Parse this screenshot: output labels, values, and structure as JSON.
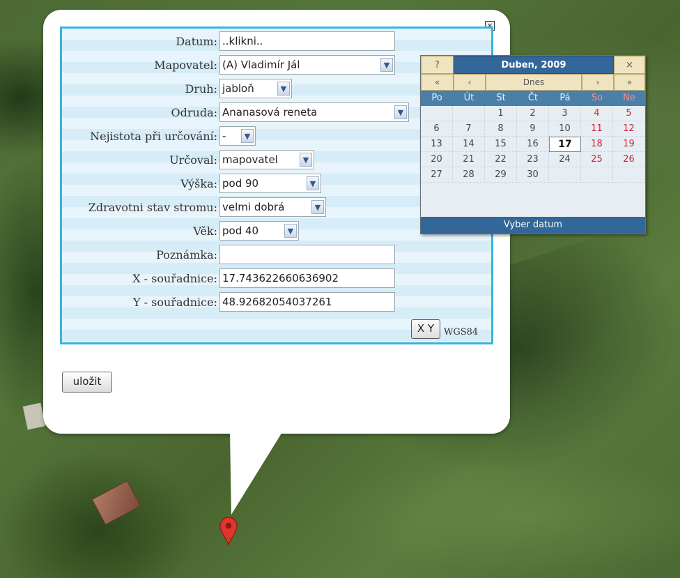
{
  "form": {
    "close_icon": "close-icon",
    "fields": [
      {
        "label": "Datum:",
        "value": "..klikni..",
        "type": "input"
      },
      {
        "label": "Mapovatel:",
        "value": "(A) Vladimír Jál",
        "type": "select"
      },
      {
        "label": "Druh:",
        "value": "jabloň",
        "type": "select"
      },
      {
        "label": "Odruda:",
        "value": "Ananasová reneta",
        "type": "select"
      },
      {
        "label": "Nejistota při určování:",
        "value": "-",
        "type": "select"
      },
      {
        "label": "Určoval:",
        "value": "mapovatel",
        "type": "select"
      },
      {
        "label": "Výška:",
        "value": "pod 90",
        "type": "select"
      },
      {
        "label": "Zdravotni stav stromu:",
        "value": "velmi dobrá",
        "type": "select"
      },
      {
        "label": "Věk:",
        "value": "pod 40",
        "type": "select"
      },
      {
        "label": "Poznámka:",
        "value": "",
        "type": "input"
      },
      {
        "label": "X - souřadnice:",
        "value": "17.743622660636902",
        "type": "input"
      },
      {
        "label": "Y - souřadnice:",
        "value": "48.92682054037261",
        "type": "input"
      }
    ],
    "xy_button": "X Y",
    "coord_system": "WGS84",
    "save_label": "uložit"
  },
  "calendar": {
    "help_label": "?",
    "title": "Duben, 2009",
    "close_label": "×",
    "nav": {
      "prev_year": "«",
      "prev_month": "‹",
      "today": "Dnes",
      "next_month": "›",
      "next_year": "»"
    },
    "weekdays": [
      "Po",
      "Út",
      "St",
      "Čt",
      "Pá",
      "So",
      "Ne"
    ],
    "weeks": [
      [
        "",
        "",
        "1",
        "2",
        "3",
        "4",
        "5"
      ],
      [
        "6",
        "7",
        "8",
        "9",
        "10",
        "11",
        "12"
      ],
      [
        "13",
        "14",
        "15",
        "16",
        "17",
        "18",
        "19"
      ],
      [
        "20",
        "21",
        "22",
        "23",
        "24",
        "25",
        "26"
      ],
      [
        "27",
        "28",
        "29",
        "30",
        "",
        "",
        ""
      ]
    ],
    "today": "17",
    "footer": "Vyber datum",
    "colors": {
      "header": "#336699",
      "weekend": "#cc2233",
      "frame": "#35b5e0"
    }
  },
  "map": {
    "marker_icon": "map-pin-icon"
  }
}
